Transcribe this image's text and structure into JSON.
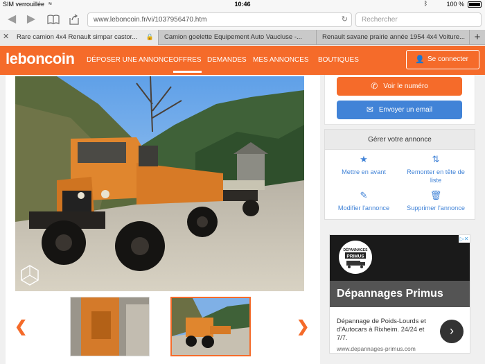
{
  "status": {
    "carrier": "SIM verrouillée",
    "time": "10:46",
    "battery": "100 %"
  },
  "browser": {
    "url": "www.leboncoin.fr/vi/1037956470.htm",
    "search_placeholder": "Rechercher",
    "tabs": [
      {
        "title": "Rare camion 4x4 Renault simpar castor..."
      },
      {
        "title": "Camion goelette Equipement Auto Vaucluse -..."
      },
      {
        "title": "Renault savane prairie année 1954 4x4 Voiture..."
      }
    ]
  },
  "site": {
    "logo": "leboncoin",
    "nav": [
      "DÉPOSER UNE ANNONCE",
      "OFFRES",
      "DEMANDES",
      "MES ANNONCES",
      "BOUTIQUES"
    ],
    "connect": "Se connecter"
  },
  "contact": {
    "call": "Voir le numéro",
    "email": "Envoyer un email"
  },
  "manage": {
    "title": "Gérer votre annonce",
    "actions": [
      {
        "label": "Mettre en avant",
        "icon": "star-icon"
      },
      {
        "label": "Remonter en tête de liste",
        "icon": "sort-up-icon"
      },
      {
        "label": "Modifier l'annonce",
        "icon": "pencil-icon"
      },
      {
        "label": "Supprimer l'annonce",
        "icon": "trash-icon"
      }
    ]
  },
  "ad": {
    "logo_text": "DÉPANNAGES PRIMUS",
    "title": "Dépannages Primus",
    "text": "Dépannage de Poids-Lourds et d'Autocars à Rixheim. 24/24 et 7/7.",
    "url": "www.depannages-primus.com"
  },
  "colors": {
    "brand": "#f56b2a",
    "email_button": "#4183d7"
  }
}
